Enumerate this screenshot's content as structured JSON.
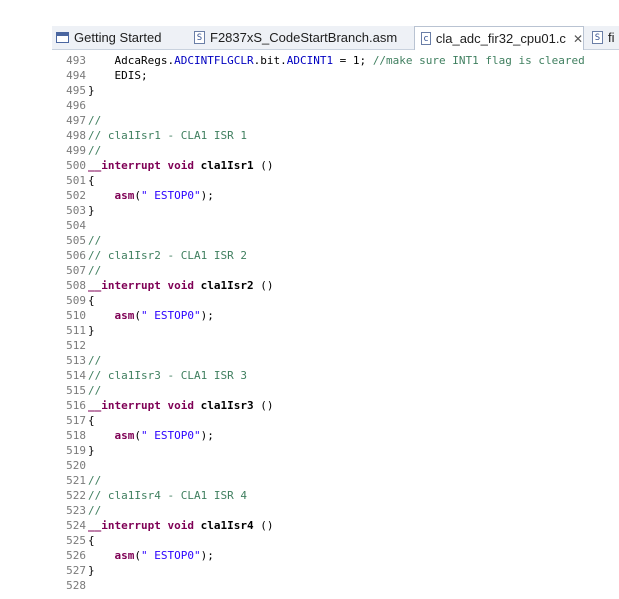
{
  "tabs": [
    {
      "label": "Getting Started",
      "icon": "page-icon"
    },
    {
      "label": "F2837xS_CodeStartBranch.asm",
      "icon": "asm-file-icon"
    },
    {
      "label": "cla_adc_fir32_cpu01.c",
      "icon": "c-file-icon",
      "active": true,
      "close": "✕"
    },
    {
      "label": "fi",
      "icon": "asm-file-icon"
    }
  ],
  "code": {
    "l493": {
      "n": "493",
      "a": "    AdcaRegs.",
      "b": "ADCINTFLGCLR",
      "c": ".bit.",
      "d": "ADCINT1",
      "e": " = 1; ",
      "f": "//make sure INT1 flag is cleared"
    },
    "l494": {
      "n": "494",
      "t": "    EDIS;"
    },
    "l495": {
      "n": "495",
      "t": "}"
    },
    "l496": {
      "n": "496"
    },
    "l497": {
      "n": "497",
      "c": "//"
    },
    "l498": {
      "n": "498",
      "c": "// cla1Isr1 - CLA1 ISR 1"
    },
    "l499": {
      "n": "499",
      "c": "//"
    },
    "l500": {
      "n": "500",
      "k": "__interrupt void ",
      "f": "cla1Isr1",
      "r": " ()"
    },
    "l501": {
      "n": "501",
      "t": "{"
    },
    "l502": {
      "n": "502",
      "k": "    asm",
      "a": "(",
      "s": "\" ESTOP0\"",
      "e": ");"
    },
    "l503": {
      "n": "503",
      "t": "}"
    },
    "l504": {
      "n": "504"
    },
    "l505": {
      "n": "505",
      "c": "//"
    },
    "l506": {
      "n": "506",
      "c": "// cla1Isr2 - CLA1 ISR 2"
    },
    "l507": {
      "n": "507",
      "c": "//"
    },
    "l508": {
      "n": "508",
      "k": "__interrupt void ",
      "f": "cla1Isr2",
      "r": " ()"
    },
    "l509": {
      "n": "509",
      "t": "{"
    },
    "l510": {
      "n": "510",
      "k": "    asm",
      "a": "(",
      "s": "\" ESTOP0\"",
      "e": ");"
    },
    "l511": {
      "n": "511",
      "t": "}"
    },
    "l512": {
      "n": "512"
    },
    "l513": {
      "n": "513",
      "c": "//"
    },
    "l514": {
      "n": "514",
      "c": "// cla1Isr3 - CLA1 ISR 3"
    },
    "l515": {
      "n": "515",
      "c": "//"
    },
    "l516": {
      "n": "516",
      "k": "__interrupt void ",
      "f": "cla1Isr3",
      "r": " ()"
    },
    "l517": {
      "n": "517",
      "t": "{"
    },
    "l518": {
      "n": "518",
      "k": "    asm",
      "a": "(",
      "s": "\" ESTOP0\"",
      "e": ");"
    },
    "l519": {
      "n": "519",
      "t": "}"
    },
    "l520": {
      "n": "520"
    },
    "l521": {
      "n": "521",
      "c": "//"
    },
    "l522": {
      "n": "522",
      "c": "// cla1Isr4 - CLA1 ISR 4"
    },
    "l523": {
      "n": "523",
      "c": "//"
    },
    "l524": {
      "n": "524",
      "k": "__interrupt void ",
      "f": "cla1Isr4",
      "r": " ()"
    },
    "l525": {
      "n": "525",
      "t": "{"
    },
    "l526": {
      "n": "526",
      "k": "    asm",
      "a": "(",
      "s": "\" ESTOP0\"",
      "e": ");"
    },
    "l527": {
      "n": "527",
      "t": "}"
    },
    "l528": {
      "n": "528"
    }
  }
}
